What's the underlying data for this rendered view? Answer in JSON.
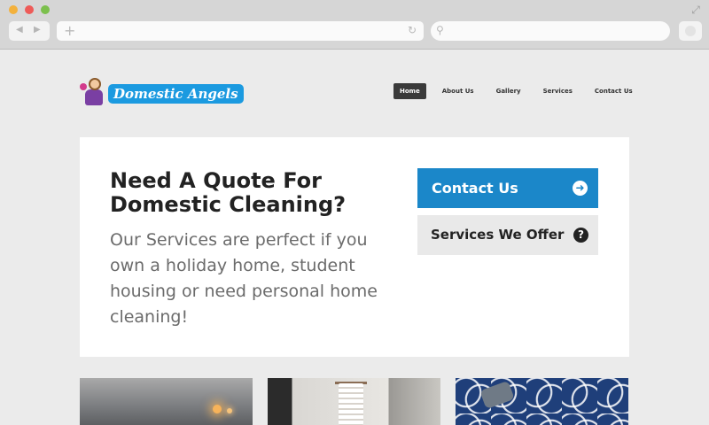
{
  "brand": {
    "name": "Domestic Angels"
  },
  "nav": {
    "items": [
      {
        "label": "Home",
        "active": true
      },
      {
        "label": "About Us",
        "active": false
      },
      {
        "label": "Gallery",
        "active": false
      },
      {
        "label": "Services",
        "active": false
      },
      {
        "label": "Contact Us",
        "active": false
      }
    ]
  },
  "hero": {
    "heading": "Need A Quote For Domestic Cleaning?",
    "subtext": "Our Services are perfect if you own a holiday home, student housing or need personal home cleaning!",
    "contact_button": {
      "label": "Contact Us",
      "icon": "arrow-circle-right-icon"
    },
    "services_button": {
      "label": "Services We Offer",
      "icon": "question-circle-icon"
    }
  },
  "colors": {
    "accent_blue": "#1b87c9",
    "logo_blue": "#1b9ae0",
    "nav_active": "#3a3a3a"
  }
}
